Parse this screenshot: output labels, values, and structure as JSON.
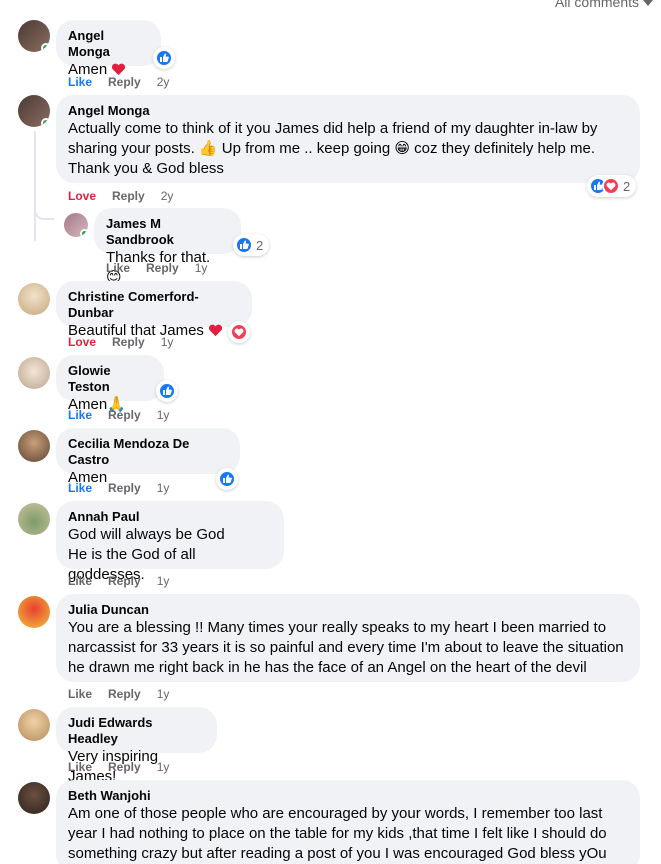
{
  "header": {
    "filter_label": "All comments"
  },
  "colors": {
    "like_blue": "#1877f2",
    "love_red": "#e41e3f",
    "bubble_bg": "#f0f2f5",
    "meta_grey": "#65676b"
  },
  "actions": {
    "like": "Like",
    "reply": "Reply",
    "love": "Love"
  },
  "comments": [
    {
      "author": "Angel Monga",
      "lines": [
        "Amen"
      ],
      "time": "2y",
      "reaction": "like",
      "reaction_count": ""
    },
    {
      "author": "Angel Monga",
      "lines": [
        "Actually come to think of it you James did help a friend of my daughter in-law by",
        "sharing your posts. 👍 Up from me .. keep going 😁 coz they definitely help me.",
        "Thank you & God bless"
      ],
      "time": "2y",
      "reaction": "like+love",
      "reaction_count": "2"
    },
    {
      "author": "James M Sandbrook",
      "lines": [
        "Thanks for that. 😊"
      ],
      "time": "1y",
      "reaction": "like",
      "reaction_count": "2",
      "is_reply": true
    },
    {
      "author": "Christine Comerford-Dunbar",
      "lines": [
        "Beautiful that James"
      ],
      "time": "1y",
      "reaction": "love",
      "reaction_count": ""
    },
    {
      "author": "Glowie Teston",
      "lines": [
        "Amen🙏"
      ],
      "time": "1y",
      "reaction": "like",
      "reaction_count": ""
    },
    {
      "author": "Cecilia Mendoza De Castro",
      "lines": [
        "Amen"
      ],
      "time": "1y",
      "reaction": "like",
      "reaction_count": ""
    },
    {
      "author": "Annah Paul",
      "lines": [
        "God will always be God",
        "He is the God of all goddesses."
      ],
      "time": "1y"
    },
    {
      "author": "Julia Duncan",
      "lines": [
        "You are a blessing !! Many times your really speaks to my heart I been married to",
        "narcassist for 33 years it is so painful and every time I'm about to leave the situation",
        "he drawn me right back in he has the face of an Angel on the heart of the devil"
      ],
      "time": "1y"
    },
    {
      "author": "Judi Edwards Headley",
      "lines": [
        "Very inspiring James!"
      ],
      "time": "1y"
    },
    {
      "author": "Beth Wanjohi",
      "lines": [
        "Am one of those people who are encouraged by your words, I remember too last",
        "year I had nothing to place on the table for my kids ,that time I felt like I should do",
        "something crazy but after reading a post of you I was encouraged God bless yOu"
      ]
    }
  ]
}
